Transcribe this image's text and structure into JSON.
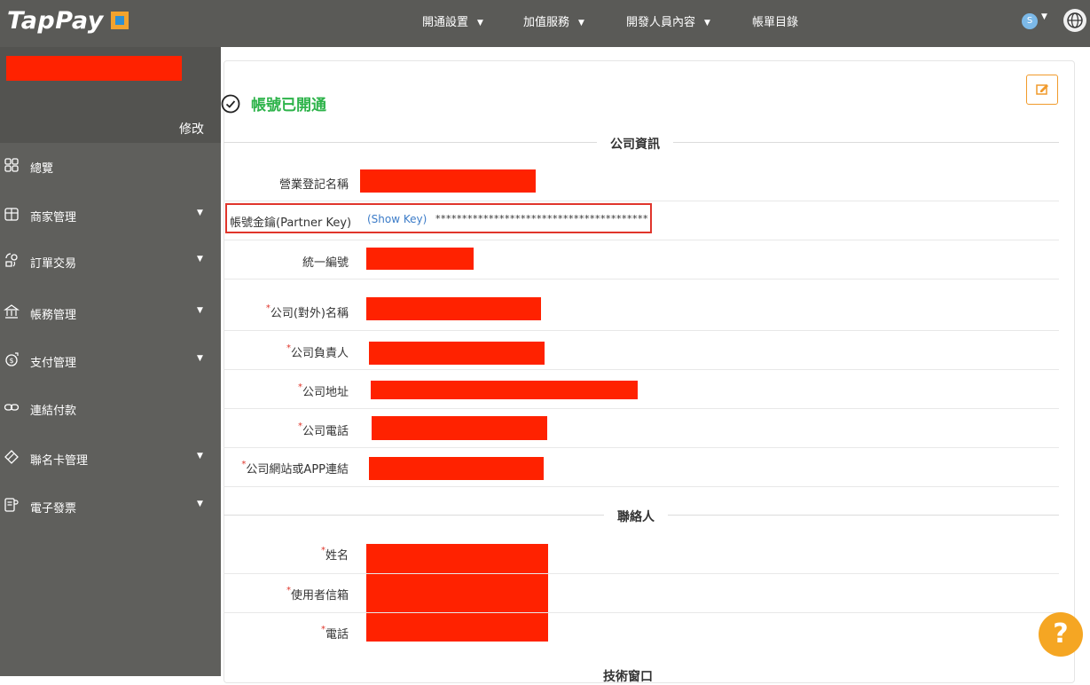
{
  "brand": {
    "name": "TapPay"
  },
  "nav": [
    {
      "label": "開通設置",
      "has_dropdown": true
    },
    {
      "label": "加值服務",
      "has_dropdown": true
    },
    {
      "label": "開發人員內容",
      "has_dropdown": true
    },
    {
      "label": "帳單目錄",
      "has_dropdown": false
    }
  ],
  "user": {
    "avatar_letter": "S"
  },
  "sidebar": {
    "edit_label": "修改",
    "items": [
      {
        "label": "總覽",
        "icon": "overview-icon",
        "has_dropdown": false
      },
      {
        "label": "商家管理",
        "icon": "store-icon",
        "has_dropdown": true
      },
      {
        "label": "訂單交易",
        "icon": "order-icon",
        "has_dropdown": true
      },
      {
        "label": "帳務管理",
        "icon": "bank-icon",
        "has_dropdown": true
      },
      {
        "label": "支付管理",
        "icon": "payment-icon",
        "has_dropdown": true
      },
      {
        "label": "連結付款",
        "icon": "link-icon",
        "has_dropdown": false
      },
      {
        "label": "聯名卡管理",
        "icon": "card-icon",
        "has_dropdown": true
      },
      {
        "label": "電子發票",
        "icon": "invoice-icon",
        "has_dropdown": true
      }
    ]
  },
  "main": {
    "status_text": "帳號已開通",
    "section_company": "公司資訊",
    "section_contact": "聯絡人",
    "section_bottom": "技術窗口",
    "fields": {
      "business_name": "營業登記名稱",
      "partner_key": "帳號金鑰(Partner Key)",
      "show_key": "(Show Key)",
      "key_mask": "****************************************",
      "tax_id": "統一編號",
      "company_public_name": "公司(對外)名稱",
      "company_owner": "公司負責人",
      "company_address": "公司地址",
      "company_phone": "公司電話",
      "company_website": "公司網站或APP連結",
      "contact_name": "姓名",
      "contact_email": "使用者信箱",
      "contact_phone": "電話"
    },
    "required_mark": "*"
  },
  "help_label": "?",
  "colors": {
    "topbar": "#5a5a57",
    "sidebar": "#5f5f5c",
    "status": "#2db34a",
    "accent": "#f5a623",
    "redaction": "#ff2200"
  }
}
